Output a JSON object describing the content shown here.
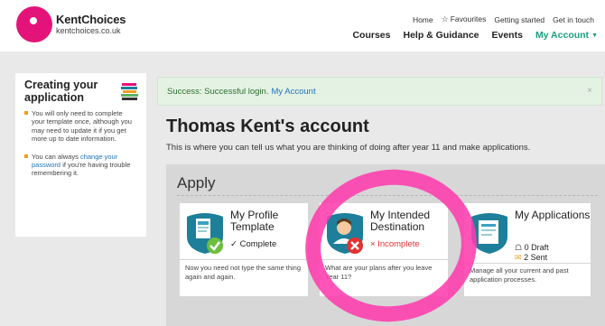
{
  "header": {
    "logo_name": "KentChoices",
    "logo_url": "kentchoices.co.uk",
    "top_links": {
      "home": "Home",
      "favourites": "Favourites",
      "getting_started": "Getting started",
      "get_in_touch": "Get in touch"
    },
    "nav": {
      "courses": "Courses",
      "help": "Help & Guidance",
      "events": "Events",
      "my_account": "My Account"
    }
  },
  "sidebar": {
    "title": "Creating your application",
    "tip1": "You will only need to complete your template once, although you may need to update it if you get more up to date information.",
    "tip2_before": "You can always ",
    "tip2_link": "change your password",
    "tip2_after": " if you're having trouble remembering it."
  },
  "alert": {
    "text": "Success: Successful login.",
    "link": "My Account",
    "close": "×"
  },
  "account": {
    "title": "Thomas Kent's account",
    "description": "This is where you can tell us what you are thinking of doing after year 11 and make applications."
  },
  "apply": {
    "title": "Apply",
    "cards": [
      {
        "heading": "My Profile Template",
        "status": "✓ Complete",
        "description": "Now you need not type the same thing again and again."
      },
      {
        "heading": "My Intended Destination",
        "status": "× Incomplete",
        "description": "What are your plans after you leave Year 11?"
      },
      {
        "heading": "My Applications",
        "draft": "0 Draft",
        "sent": "2 Sent",
        "description": "Manage all your current and past application processes."
      }
    ]
  },
  "colors": {
    "brand_pink": "#e4137a",
    "accent_green": "#1a9e7e",
    "status_red": "#e23232",
    "highlight": "#ff3cad",
    "icon_teal": "#1d7f9a"
  }
}
